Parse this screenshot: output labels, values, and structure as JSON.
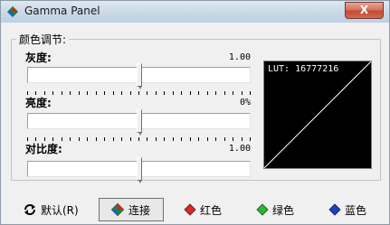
{
  "window": {
    "title": "Gamma Panel",
    "close_label": "X"
  },
  "group": {
    "title": "颜色调节:"
  },
  "sliders": [
    {
      "label": "灰度:",
      "value": "1.00",
      "fraction": 0.5
    },
    {
      "label": "亮度:",
      "value": "0%",
      "fraction": 0.5
    },
    {
      "label": "对比度:",
      "value": "1.00",
      "fraction": 0.5
    }
  ],
  "lut": {
    "text": "LUT: 16777216"
  },
  "buttons": {
    "default_label": "默认(R)",
    "link_label": "连接",
    "red_label": "红色",
    "green_label": "绿色",
    "blue_label": "蓝色"
  },
  "colors": {
    "red": "#d42a2a",
    "green": "#2fb52f",
    "blue": "#1c3fc0"
  }
}
